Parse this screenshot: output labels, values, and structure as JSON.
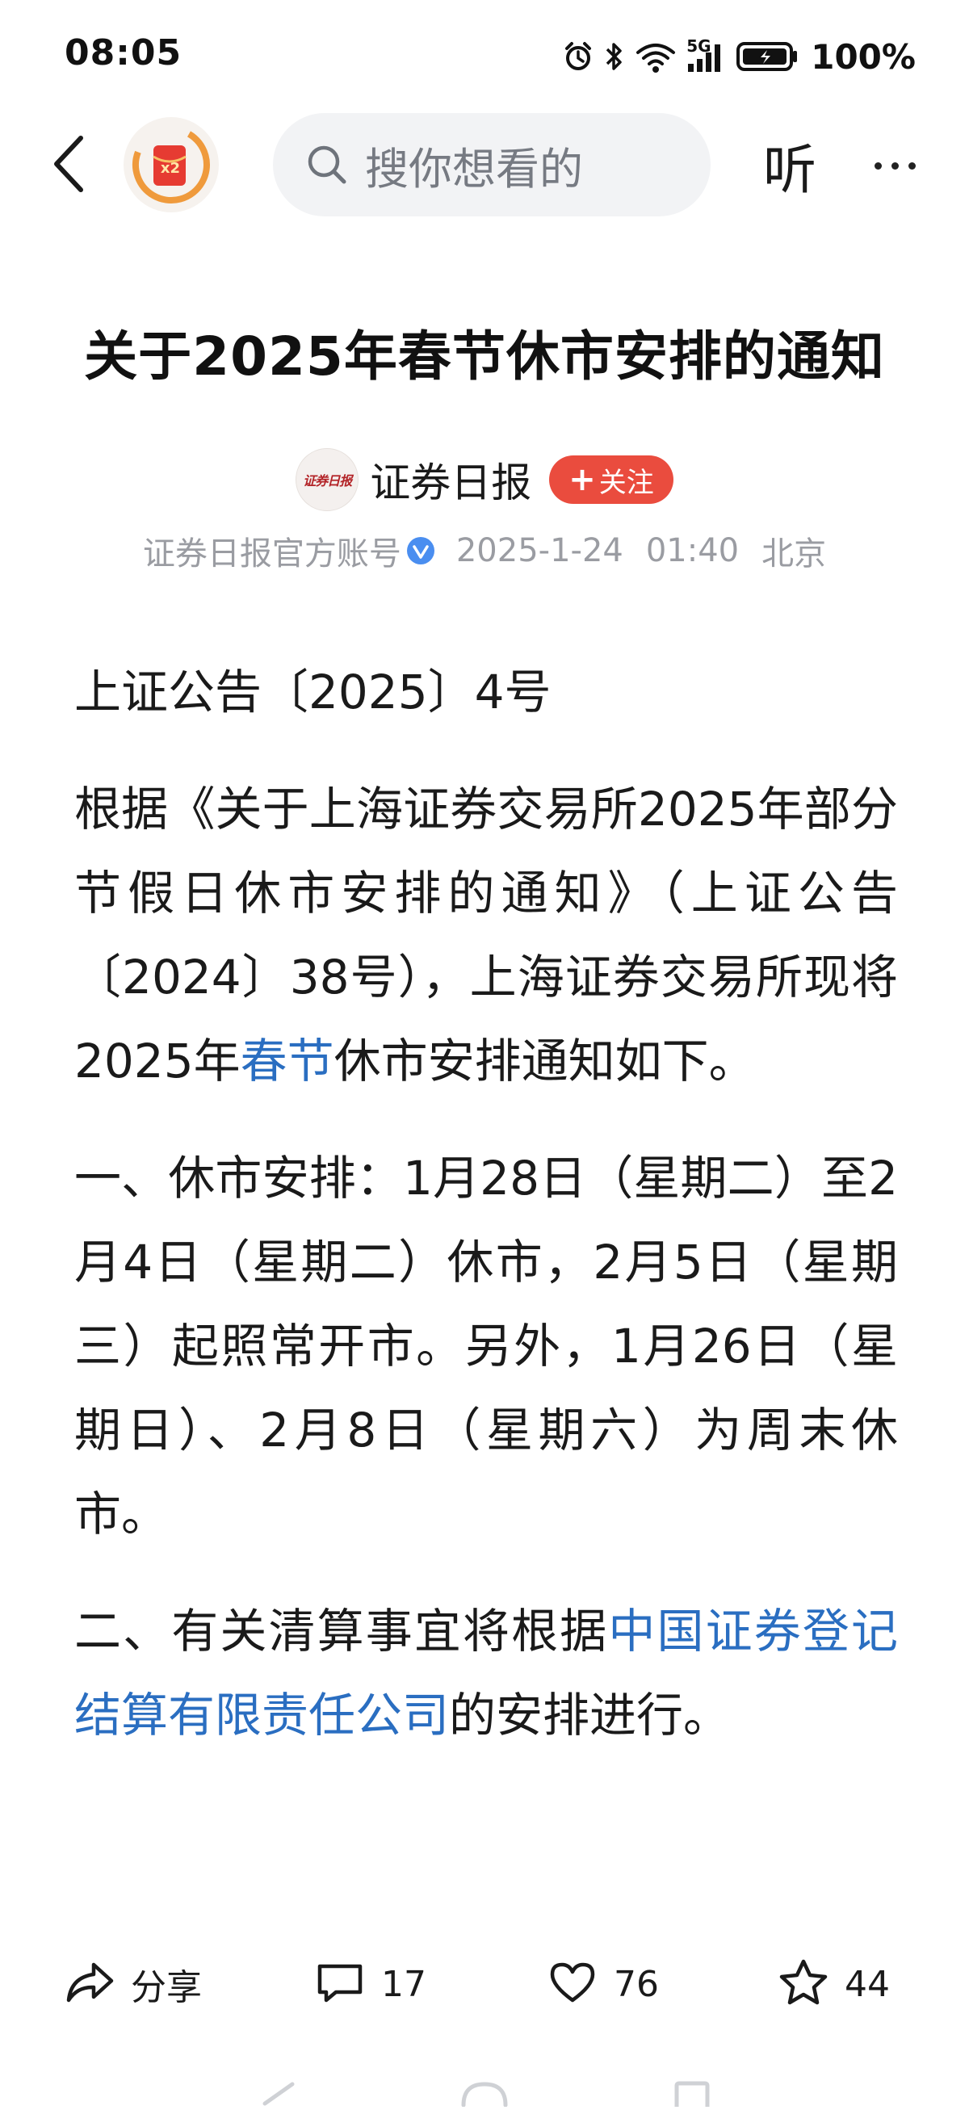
{
  "status_bar": {
    "time": "08:05",
    "network": "5G",
    "battery": "100%"
  },
  "top_nav": {
    "reward_badge": "x2",
    "search_placeholder": "搜你想看的",
    "listen_label": "听"
  },
  "article": {
    "title": "关于2025年春节休市安排的通知",
    "author": {
      "name": "证券日报",
      "avatar_text": "证券日报",
      "follow_label": "关注",
      "account_label": "证券日报官方账号",
      "date": "2025-1-24",
      "time": "01:40",
      "location": "北京"
    },
    "body": {
      "p1": "上证公告〔2025〕4号",
      "p2_before": "根据《关于上海证券交易所2025年部分节假日休市安排的通知》（上证公告〔2024〕38号），上海证券交易所现将2025年",
      "p2_link": "春节",
      "p2_after": "休市安排通知如下。",
      "p3": "一、休市安排：1月28日（星期二）至2月4日（星期二）休市，2月5日（星期三）起照常开市。另外，1月26日（星期日）、2月8日（星期六）为周末休市。",
      "p4_before": "二、有关清算事宜将根据",
      "p4_link": "中国证券登记结算有限责任公司",
      "p4_after": "的安排进行。"
    }
  },
  "action_bar": {
    "share_label": "分享",
    "comment_count": "17",
    "like_count": "76",
    "collect_count": "44"
  },
  "icons": {
    "back": "chevron-left-icon",
    "search": "search-icon",
    "more": "more-dots-icon",
    "verified": "verified-badge-icon",
    "share": "share-arrow-icon",
    "comment": "comment-bubble-icon",
    "like": "heart-icon",
    "collect": "star-icon"
  },
  "colors": {
    "accent_red": "#ea4c3e",
    "link_blue": "#2a6ec1",
    "meta_gray": "#9a9ca2",
    "verified_blue": "#4a8ef0",
    "search_bg": "#f2f3f5"
  }
}
